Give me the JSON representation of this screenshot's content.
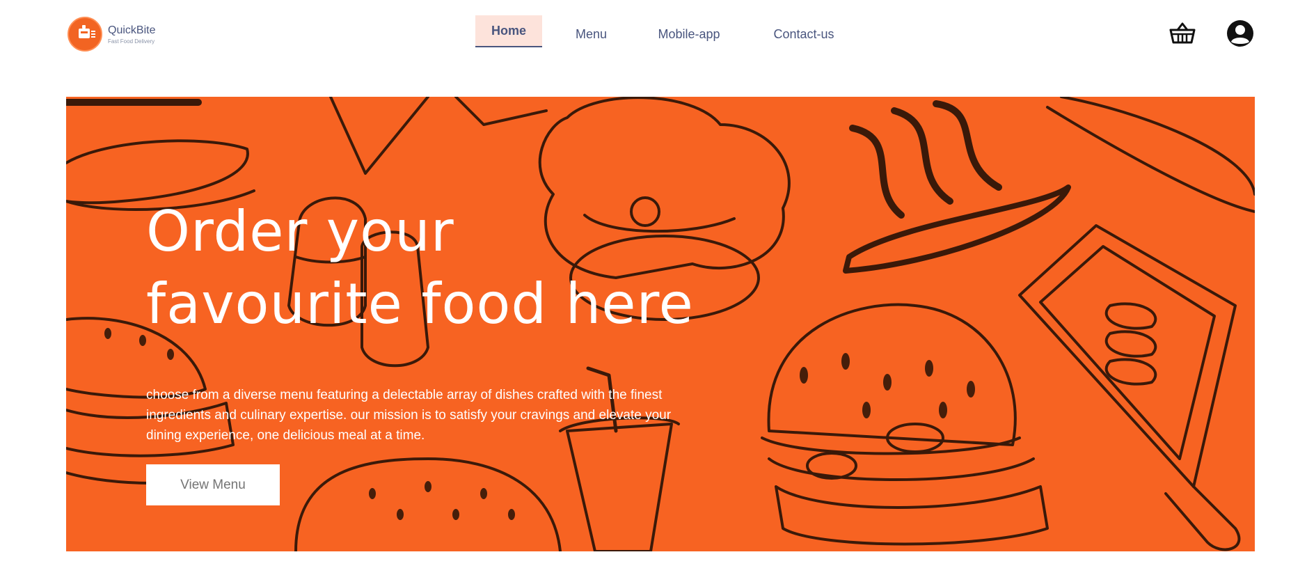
{
  "brand": {
    "name": "QuickBite",
    "tagline": "Fast Food Delivery"
  },
  "nav": {
    "items": [
      {
        "label": "Home",
        "active": true
      },
      {
        "label": "Menu"
      },
      {
        "label": "Mobile-app"
      },
      {
        "label": "Contact-us"
      }
    ]
  },
  "icons": {
    "cart": "basket-icon",
    "profile": "profile-icon"
  },
  "hero": {
    "title_line1": "Order your",
    "title_line2": "favourite food here",
    "description_line1": "choose from a diverse menu featuring a delectable array of dishes crafted with the finest",
    "description_line2": "ingredients and culinary expertise. our mission is to satisfy your cravings and elevate your",
    "description_line3": "dining experience, one delicious meal at a time.",
    "button_label": "View Menu"
  },
  "colors": {
    "accent": "#f76322",
    "nav_active_bg": "#fde3db",
    "text": "#49557e"
  }
}
